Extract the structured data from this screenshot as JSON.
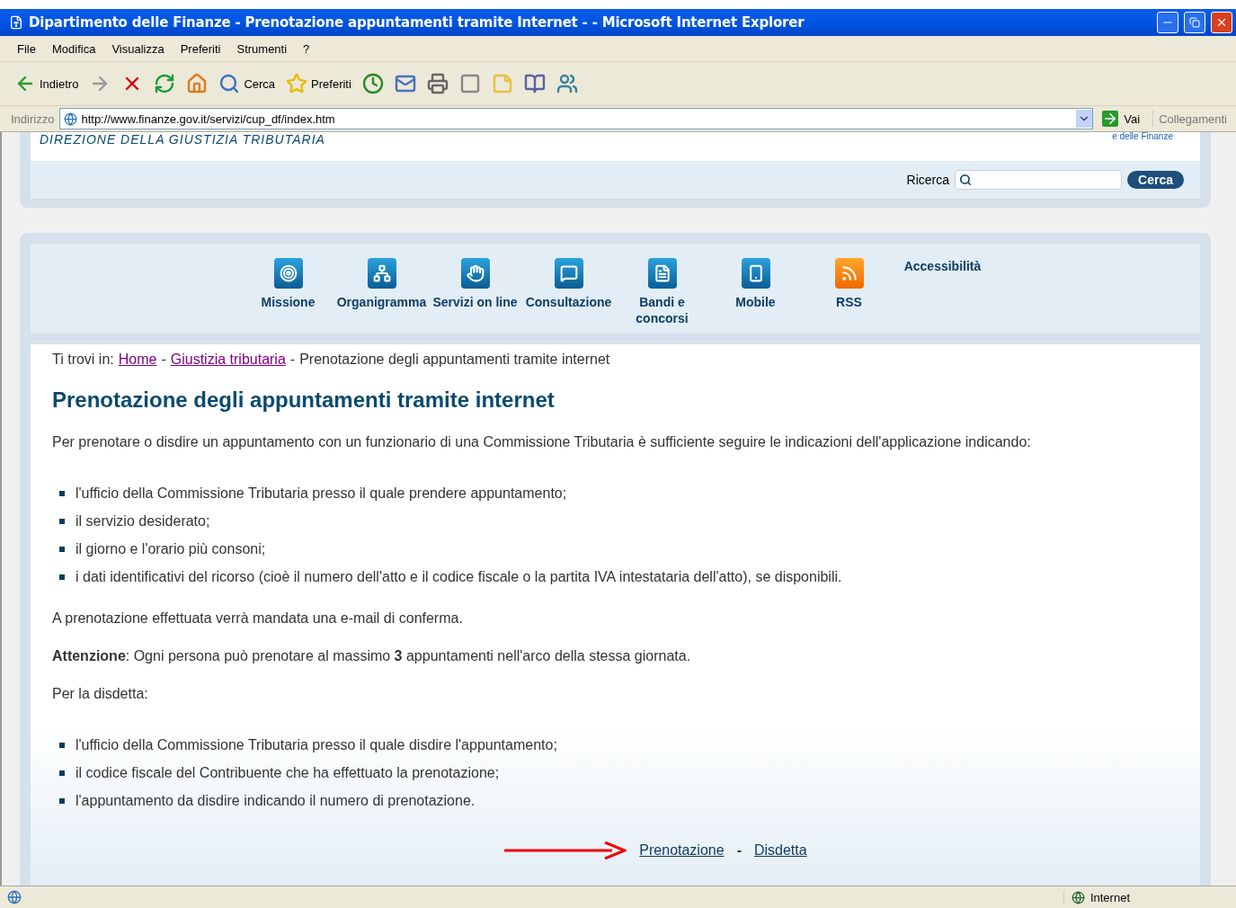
{
  "window": {
    "title": "Dipartimento delle Finanze - Prenotazione appuntamenti tramite Internet - - Microsoft Internet Explorer"
  },
  "menu": [
    "File",
    "Modifica",
    "Visualizza",
    "Preferiti",
    "Strumenti",
    "?"
  ],
  "toolbar": [
    {
      "kind": "back",
      "label": "Indietro"
    },
    {
      "kind": "forward"
    },
    {
      "kind": "stop"
    },
    {
      "kind": "refresh"
    },
    {
      "kind": "home"
    },
    {
      "kind": "search",
      "label": "Cerca"
    },
    {
      "kind": "favorites",
      "label": "Preferiti"
    },
    {
      "kind": "history"
    },
    {
      "kind": "mail"
    },
    {
      "kind": "print"
    },
    {
      "kind": "edit"
    },
    {
      "kind": "folder"
    },
    {
      "kind": "research"
    },
    {
      "kind": "messenger"
    }
  ],
  "address": {
    "label": "Indirizzo",
    "url": "http://www.finanze.gov.it/servizi/cup_df/index.htm",
    "go": "Vai",
    "links": "Collegamenti"
  },
  "header": {
    "org": "DIREZIONE DELLA GIUSTIZIA TRIBUTARIA",
    "org_right": "e delle Finanze",
    "search_label": "Ricerca",
    "search_button": "Cerca"
  },
  "nav": [
    {
      "kind": "target",
      "label": "Missione"
    },
    {
      "kind": "chart",
      "label": "Organigramma"
    },
    {
      "kind": "hand",
      "label": "Servizi on line"
    },
    {
      "kind": "chat",
      "label": "Consultazione"
    },
    {
      "kind": "doc",
      "label": "Bandi e concorsi"
    },
    {
      "kind": "phone",
      "label": "Mobile"
    },
    {
      "kind": "rss",
      "label": "RSS"
    },
    {
      "kind": "text",
      "label": "Accessibilità"
    }
  ],
  "breadcrumb": {
    "prefix": "Ti trovi in:",
    "separator": "-",
    "links": [
      "Home",
      "Giustizia tributaria"
    ],
    "current": "Prenotazione degli appuntamenti tramite internet"
  },
  "heading": "Prenotazione degli appuntamenti tramite internet",
  "intro": "Per prenotare o disdire un appuntamento con un funzionario di una Commissione Tributaria è sufficiente seguire le indicazioni dell'applicazione indicando:",
  "booking_list": [
    "l'ufficio della Commissione Tributaria presso il quale prendere appuntamento;",
    "il servizio desiderato;",
    "il giorno e l'orario più consoni;",
    "i dati identificativi del ricorso (cioè il numero dell'atto e il codice fiscale o la partita IVA intestataria dell'atto), se disponibili."
  ],
  "confirmation": "A prenotazione effettuata verrà mandata una e-mail di conferma.",
  "attention": "**Attenzione**: Ogni persona può prenotare al massimo **3** appuntamenti nell'arco della stessa giornata.",
  "cancel_intro": "Per la disdetta:",
  "cancel_list": [
    "l'ufficio della Commissione Tributaria presso il quale disdire l'appuntamento;",
    "il codice fiscale del Contribuente che ha effettuato la prenotazione;",
    "l'appuntamento da disdire indicando il numero di prenotazione."
  ],
  "actions": {
    "book": "Prenotazione",
    "separator": "-",
    "cancel": "Disdetta"
  },
  "status_bar": {
    "zone": "Internet"
  }
}
